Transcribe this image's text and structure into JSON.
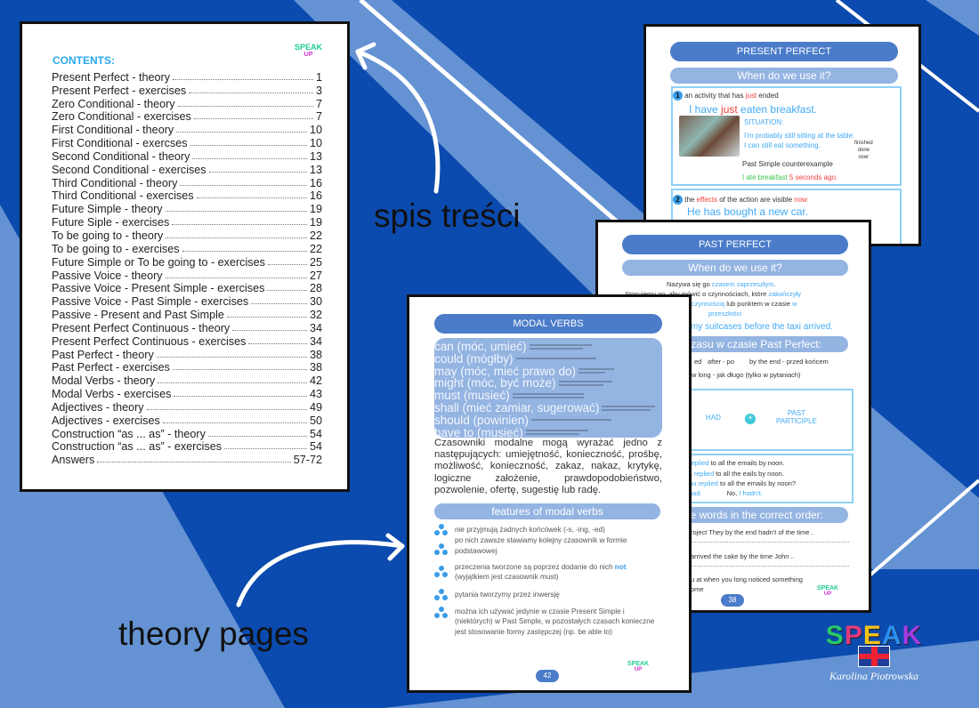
{
  "colors": {
    "background_dark": "#0b4aae",
    "background_light": "#6492d3",
    "header_pill": "#4a7cc9",
    "subheader_pill": "#94b4e2",
    "accent_blue": "#3fa9f5",
    "accent_red": "#f0403a"
  },
  "labels": {
    "contents_caption": "spis treści",
    "theory_caption": "theory pages"
  },
  "contents": {
    "title": "CONTENTS:",
    "entries": [
      {
        "t": "Present Perfect - theory",
        "p": "1"
      },
      {
        "t": "Present Perfect - exercises",
        "p": "3"
      },
      {
        "t": "Zero Conditional - theory",
        "p": "7"
      },
      {
        "t": "Zero Conditional - exercises",
        "p": "7"
      },
      {
        "t": "First Conditional - theory",
        "p": "10"
      },
      {
        "t": "First Conditional - exercses",
        "p": "10"
      },
      {
        "t": "Second Conditional - theory",
        "p": "13"
      },
      {
        "t": "Second Conditional - exercises",
        "p": "13"
      },
      {
        "t": "Third Conditional - theory",
        "p": "16"
      },
      {
        "t": "Third Conditional - exercises",
        "p": "16"
      },
      {
        "t": "Future Simple - theory",
        "p": "19"
      },
      {
        "t": "Future Siple - exercises",
        "p": "19"
      },
      {
        "t": "To be going to - theory",
        "p": "22"
      },
      {
        "t": "To be going to - exercises",
        "p": "22"
      },
      {
        "t": "Future Simple or To be going to - exercises",
        "p": "25"
      },
      {
        "t": "Passive Voice - theory",
        "p": "27"
      },
      {
        "t": "Passive Voice - Present Simple - exercises",
        "p": "28"
      },
      {
        "t": "Passive Voice - Past Simple - exercises",
        "p": "30"
      },
      {
        "t": "Passive - Present and Past Simple",
        "p": "32"
      },
      {
        "t": "Present Perfect Continuous - theory",
        "p": "34"
      },
      {
        "t": "Present Perfect Continuous - exercises",
        "p": "34"
      },
      {
        "t": "Past Perfect - theory",
        "p": "38"
      },
      {
        "t": "Past Perfect - exercises",
        "p": "38"
      },
      {
        "t": "Modal Verbs - theory",
        "p": "42"
      },
      {
        "t": "Modal Verbs - exercises",
        "p": "43"
      },
      {
        "t": "Adjectives - theory",
        "p": "49"
      },
      {
        "t": "Adjectives - exercises",
        "p": "50"
      },
      {
        "t": "Construction “as ... as” - theory",
        "p": "54"
      },
      {
        "t": "Construction “as ... as” - exercises",
        "p": "54"
      },
      {
        "t": "Answers",
        "p": "57-72"
      }
    ]
  },
  "logo": {
    "text": "SPEAK",
    "sub": "UP",
    "author": "Karolina Piotrowska"
  },
  "present_perfect": {
    "header": "PRESENT PERFECT",
    "subheader": "When do we use it?",
    "n1": "1",
    "use1_a": "an activity that has ",
    "use1_b": "just",
    "use1_c": " ended",
    "ex1_a": "I have ",
    "ex1_b": "just",
    "ex1_c": " eaten breakfast.",
    "situation": "SITUATION:",
    "sit1": "I'm probably still sitting at the table.",
    "sit2": "I can still eat something.",
    "note": [
      "finished",
      "done",
      "over"
    ],
    "counter": "Past Simple counterexample",
    "ce_a": "I ate breakfast ",
    "ce_b": "5 seconds ago.",
    "n2": "2",
    "use2_a": "the ",
    "use2_b": "effects",
    "use2_c": " of the action are visible ",
    "use2_d": "now",
    "ex2": "He has bought a new car."
  },
  "past_perfect": {
    "header": "PAST PERFECT",
    "subheader": "When do we use it?",
    "l1_a": "Nazywa się go ",
    "l1_b": "czasem zaprzeszłym",
    "l2_a": "Stosujemy go, aby mówić o czynnościach, które ",
    "l2_b": "zakończyły",
    "l3_a": "czynnością",
    "l3_b": " lub punktem w czasie ",
    "l3_c": "w",
    "l4": "przeszłości",
    "ex": "my suitcases before the taxi arrived.",
    "markers_title": "ki czasu w czasie Past Perfect:",
    "m1": "ed",
    "m2": "after - po",
    "m3": "by the end - przed końcem",
    "m4": "w long - jak długo (tylko w pytaniach)",
    "had": "HAD",
    "past": "PAST",
    "participle": "PARTICIPLE",
    "s1_a": "replied",
    "s1_b": " to all the emails by noon.",
    "s2_a": "'t replied",
    "s2_b": " to all the eails by noon.",
    "s3_a": "ou replied",
    "s3_b": " to all the emails by noon?",
    "s4_a": "had.",
    "s4_b": "No, ",
    "s4_c": "I hadn't.",
    "exercise_title": "he words in the correct order:",
    "e1": "roject They by the end hadn't of the  time .",
    "e2": "arrived the cake by  the time John ..",
    "e3": "u  at  when you long noticed  something",
    "e4": "ome",
    "page": "38"
  },
  "modal_verbs": {
    "header": "MODAL VERBS",
    "verbs": [
      "can (móc, umieć)",
      "could (mógłby)",
      "may (móc, mieć prawo do)",
      "might (móc, być może)",
      "must (musieć)",
      "shall (mieć zamiar, sugerować)",
      "should (powinien)",
      "have to (musieć)"
    ],
    "paragraph": "Czasowniki modalne mogą wyrażać jedno z następujących: umiejętność, konieczność, prośbę, możliwość, konieczność, zakaz, nakaz, krytykę, logiczne założenie, prawdopodobieństwo, pozwolenie, ofertę, sugestię lub radę.",
    "features_title": "features of modal verbs",
    "f1": "nie przyjmują żadnych końcówek (-s, -ing, -ed)",
    "f2": "po nich zawsze stawiamy kolejny czasownik w formie podstawowej",
    "f3_a": "przeczenia tworzone są poprzez dodanie do nich ",
    "f3_b": "not",
    "f3_c": " (wyjątkiem jest czasownik must)",
    "f4": "pytania tworzymy przez inwersję",
    "f5": "można ich używać jedynie w czasie Present Simple i (niektórych) w Past Simple, w pozostałych czasach konieczne jest stosowanie formy zastępczej (np. be able to)",
    "page": "42"
  }
}
